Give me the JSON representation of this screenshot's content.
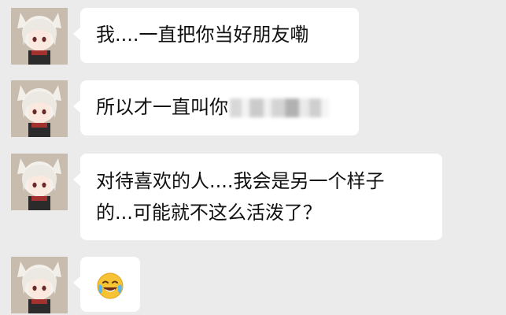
{
  "messages": [
    {
      "text": "我....一直把你当好朋友嘞"
    },
    {
      "text": "所以才一直叫你",
      "redacted": true
    },
    {
      "line1": "对待喜欢的人....我会是另一个样子",
      "line2": "的...可能就不这么活泼了？"
    },
    {
      "emoji": "face-with-tears-of-joy"
    }
  ],
  "colors": {
    "background": "#ebebeb",
    "bubble": "#ffffff",
    "text": "#111111"
  }
}
